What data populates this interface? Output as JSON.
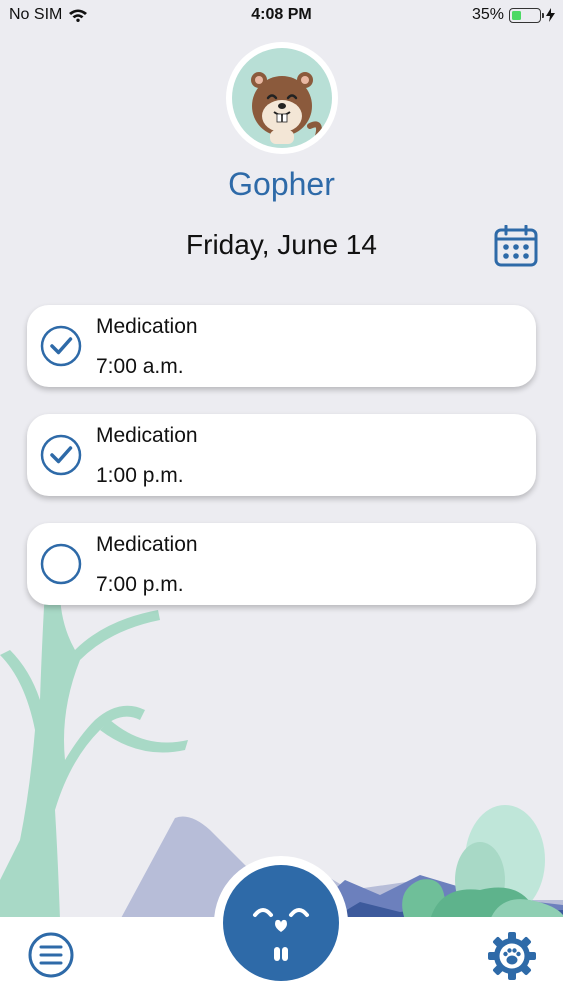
{
  "status_bar": {
    "carrier": "No SIM",
    "time": "4:08 PM",
    "battery_percent": "35%",
    "battery_level": 0.35
  },
  "profile": {
    "name": "Gopher",
    "avatar_icon": "gopher-avatar-icon"
  },
  "date_row": {
    "date": "Friday, June 14",
    "calendar_icon": "calendar-icon"
  },
  "tasks": [
    {
      "title": "Medication",
      "time": "7:00 a.m.",
      "completed": true
    },
    {
      "title": "Medication",
      "time": "1:00 p.m.",
      "completed": true
    },
    {
      "title": "Medication",
      "time": "7:00 p.m.",
      "completed": false
    }
  ],
  "bottom_nav": {
    "menu_icon": "hamburger-menu-icon",
    "center_icon": "gopher-face-icon",
    "settings_icon": "paw-gear-icon"
  },
  "colors": {
    "accent": "#2e6aa8",
    "background": "#ececf1",
    "battery": "#4cd964",
    "tree": "#a8d9c6"
  }
}
